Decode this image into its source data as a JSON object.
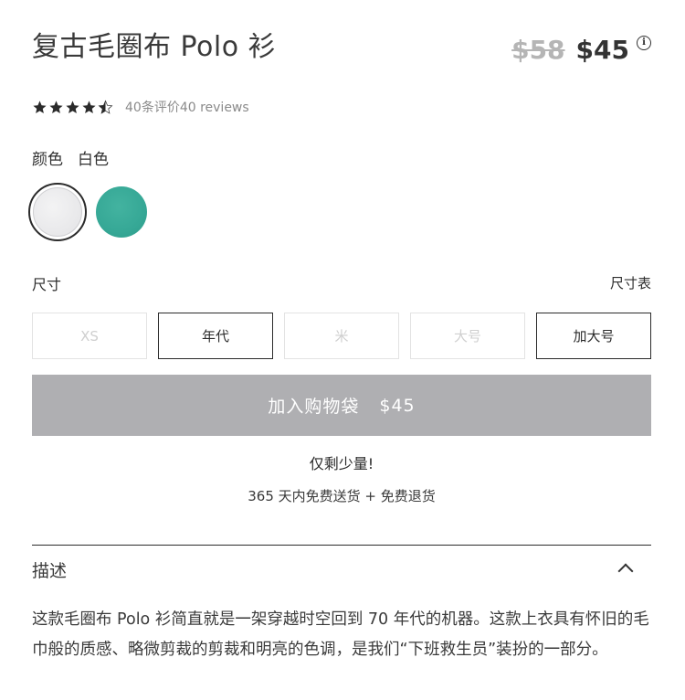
{
  "product": {
    "title": "复古毛圈布 Polo 衫",
    "price_original": "$58",
    "price_current": "$45"
  },
  "rating": {
    "stars": 4.5,
    "text": "40条评价40 reviews"
  },
  "color": {
    "label": "颜色",
    "selected": "白色",
    "options": [
      {
        "name": "white",
        "hex": "#e8e8ea",
        "selected": true
      },
      {
        "name": "teal",
        "hex": "#36a896",
        "selected": false
      }
    ]
  },
  "size": {
    "label": "尺寸",
    "chart_link": "尺寸表",
    "options": [
      {
        "label": "XS",
        "available": false
      },
      {
        "label": "年代",
        "available": true
      },
      {
        "label": "米",
        "available": false
      },
      {
        "label": "大号",
        "available": false
      },
      {
        "label": "加大号",
        "available": true
      }
    ]
  },
  "add_to_bag": {
    "label": "加入购物袋",
    "price": "$45",
    "color": "#afafb2"
  },
  "low_stock": "仅剩少量!",
  "shipping": "365 天内免费送货 + 免费退货",
  "description": {
    "title": "描述",
    "body": "这款毛圈布 Polo 衫简直就是一架穿越时空回到 70 年代的机器。这款上衣具有怀旧的毛巾般的质感、略微剪裁的剪裁和明亮的色调，是我们“下班救生员”装扮的一部分。"
  }
}
